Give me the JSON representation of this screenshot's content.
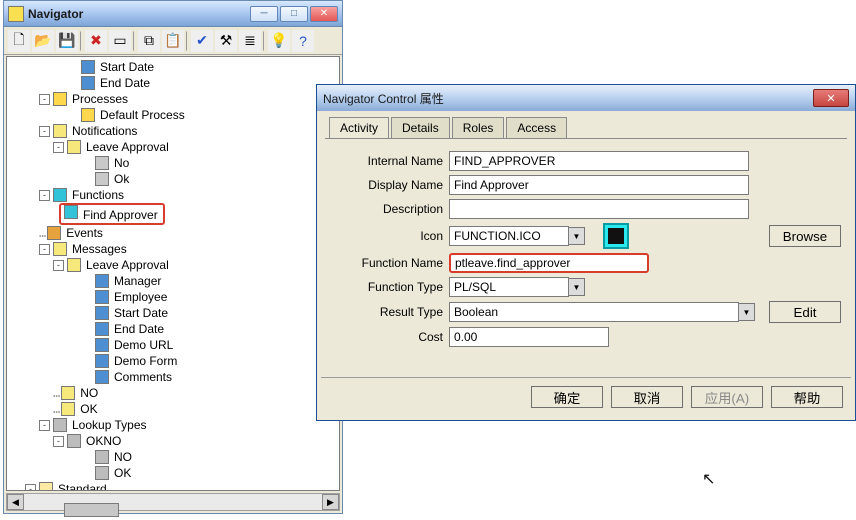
{
  "navigator": {
    "title": "Navigator",
    "nodes": {
      "startdate": "Start Date",
      "enddate": "End Date",
      "processes": "Processes",
      "defaultprocess": "Default Process",
      "notifications": "Notifications",
      "leaveapproval": "Leave Approval",
      "no": "No",
      "ok": "Ok",
      "functions": "Functions",
      "findapprover": "Find Approver",
      "events": "Events",
      "messages": "Messages",
      "leaveapproval2": "Leave Approval",
      "manager": "Manager",
      "employee": "Employee",
      "startdate2": "Start Date",
      "enddate2": "End Date",
      "demourl": "Demo URL",
      "demoform": "Demo Form",
      "comments": "Comments",
      "no2": "NO",
      "ok2": "OK",
      "lookuptypes": "Lookup Types",
      "okno": "OKNO",
      "no3": "NO",
      "ok3": "OK",
      "standard": "Standard"
    }
  },
  "dialog": {
    "title": "Navigator Control 属性",
    "tabs": {
      "activity": "Activity",
      "details": "Details",
      "roles": "Roles",
      "access": "Access"
    },
    "labels": {
      "internalname": "Internal Name",
      "displayname": "Display Name",
      "description": "Description",
      "icon": "Icon",
      "functionname": "Function Name",
      "functiontype": "Function Type",
      "resulttype": "Result Type",
      "cost": "Cost"
    },
    "values": {
      "internalname": "FIND_APPROVER",
      "displayname": "Find Approver",
      "description": "",
      "icon": "FUNCTION.ICO",
      "functionname": "ptleave.find_approver",
      "functiontype": "PL/SQL",
      "resulttype": "Boolean",
      "cost": "0.00"
    },
    "buttons": {
      "browse": "Browse",
      "edit": "Edit",
      "ok": "确定",
      "cancel": "取消",
      "apply": "应用(A)",
      "help": "帮助"
    }
  }
}
